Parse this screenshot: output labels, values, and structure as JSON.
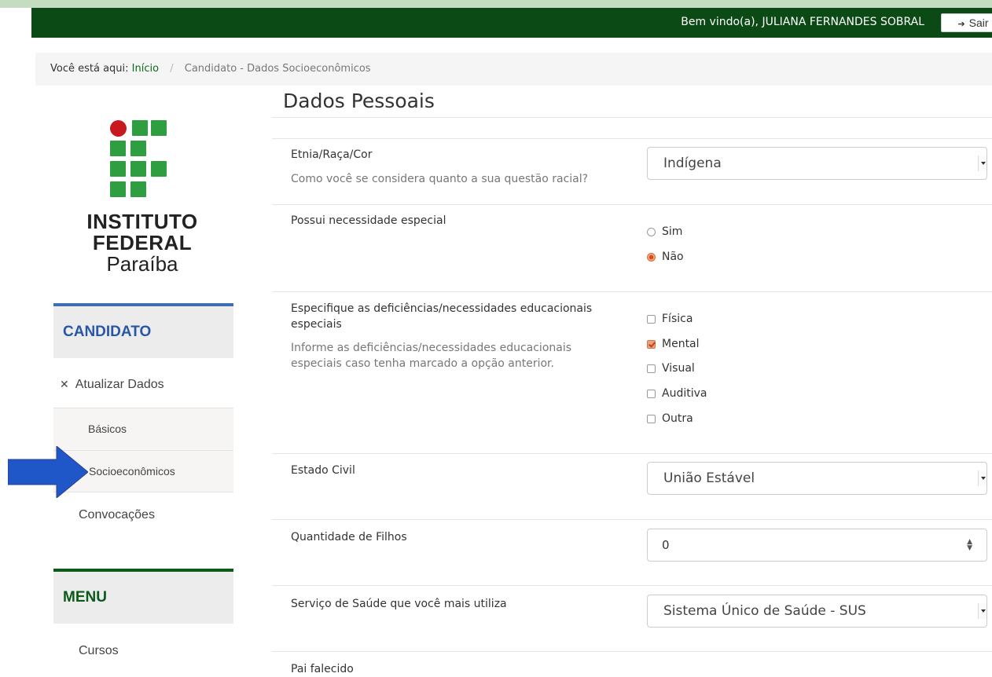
{
  "header": {
    "welcome": "Bem vindo(a), JULIANA FERNANDES SOBRAL",
    "logout_label": "Sair"
  },
  "breadcrumb": {
    "prefix": "Você está aqui:",
    "home": "Início",
    "current": "Candidato - Dados Socioeconômicos"
  },
  "logo": {
    "line1": "INSTITUTO",
    "line2": "FEDERAL",
    "line3": "Paraíba"
  },
  "sidebar": {
    "candidato_title": "CANDIDATO",
    "atualizar_label": "Atualizar Dados",
    "basicos_label": "Básicos",
    "socio_label": "Socioeconômicos",
    "convocacoes_label": "Convocações",
    "menu_title": "MENU",
    "cursos_label": "Cursos"
  },
  "form": {
    "title": "Dados Pessoais",
    "etnia": {
      "label": "Etnia/Raça/Cor",
      "help": "Como você se considera quanto a sua questão racial?",
      "value": "Indígena"
    },
    "necessidade": {
      "label": "Possui necessidade especial",
      "options": [
        "Sim",
        "Não"
      ],
      "selected": "Não"
    },
    "deficiencias": {
      "label": "Especifique as deficiências/necessidades educacionais especiais",
      "help": "Informe as deficiências/necessidades educacionais especiais caso tenha marcado a opção anterior.",
      "options": [
        "Física",
        "Mental",
        "Visual",
        "Auditiva",
        "Outra"
      ],
      "checked": [
        "Mental"
      ]
    },
    "estado_civil": {
      "label": "Estado Civil",
      "value": "União Estável"
    },
    "filhos": {
      "label": "Quantidade de Filhos",
      "value": "0"
    },
    "saude": {
      "label": "Serviço de Saúde que você mais utiliza",
      "value": "Sistema Único de Saúde - SUS"
    },
    "pai_falecido": {
      "label": "Pai falecido"
    }
  },
  "colors": {
    "topbar": "#0b4a14",
    "link_green": "#0b6a1a",
    "candidato_blue": "#2a56a6",
    "menu_green": "#0b5a1a",
    "arrow_blue": "#1f57c8"
  }
}
